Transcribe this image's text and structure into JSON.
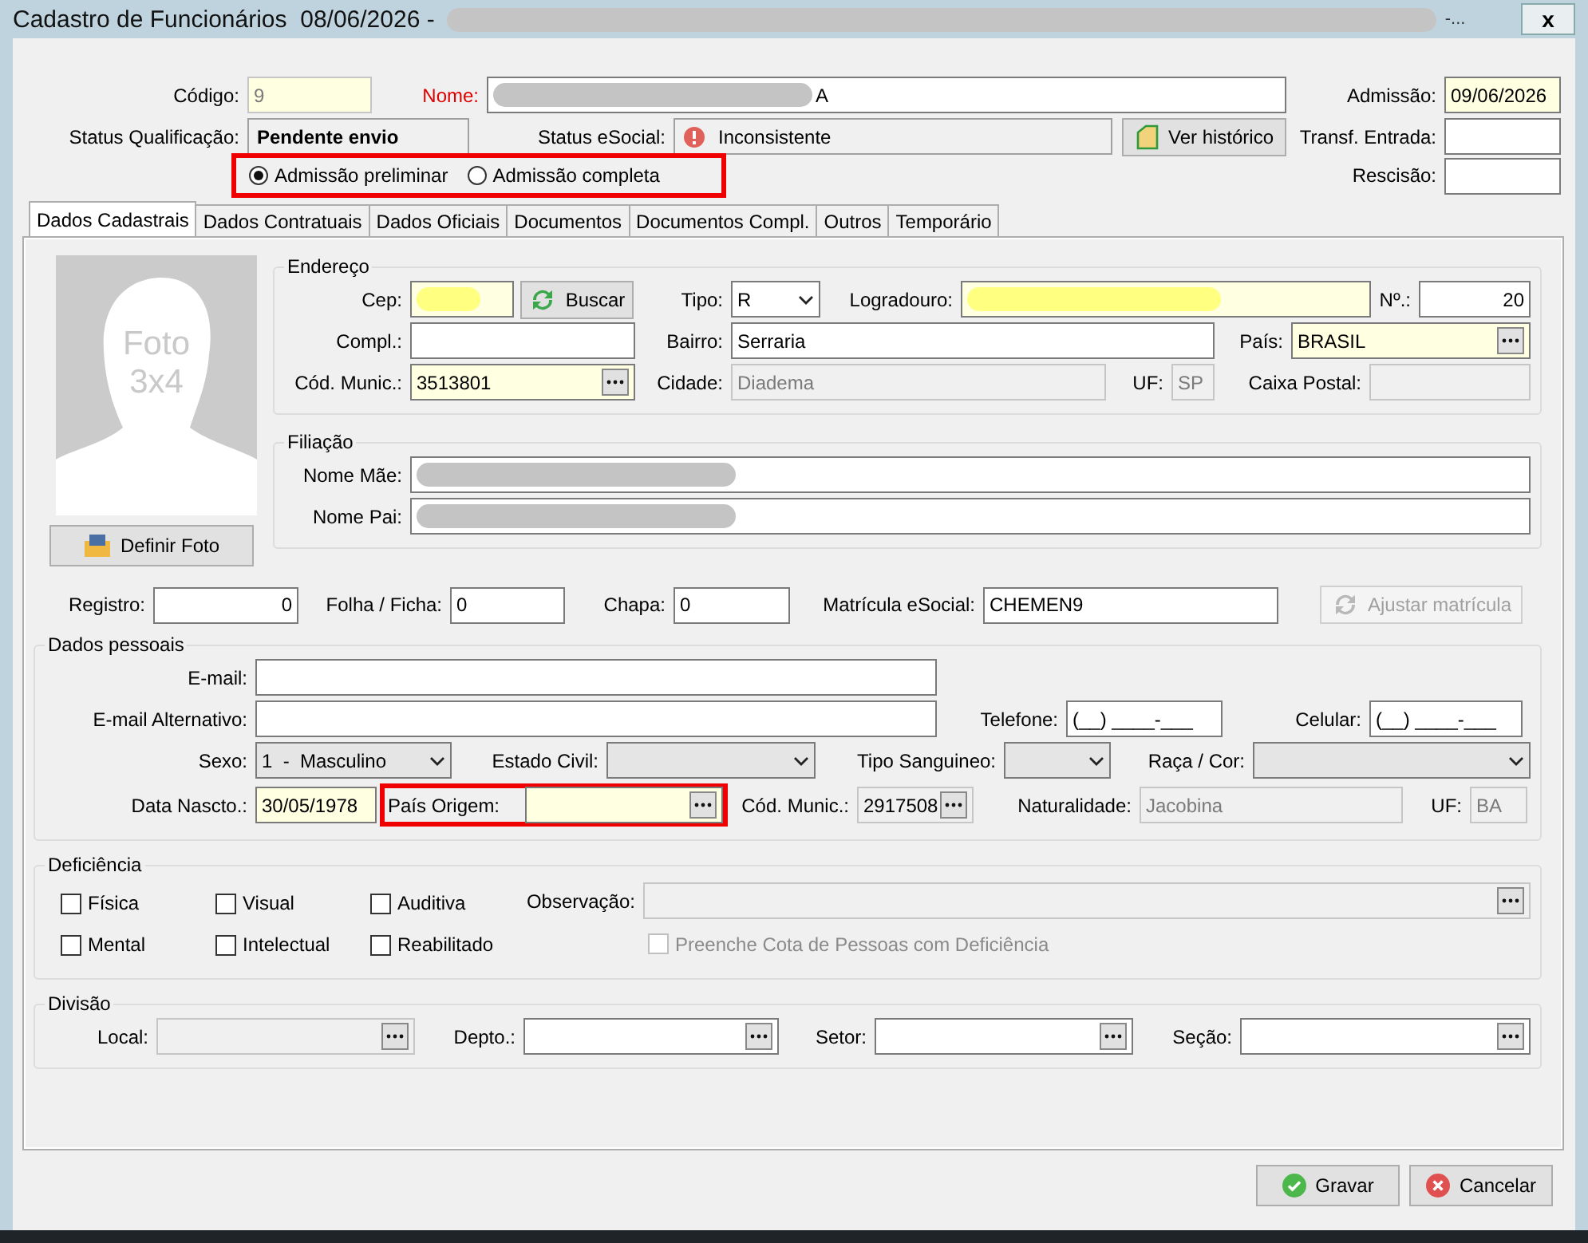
{
  "window": {
    "title": "Cadastro de Funcionários  08/06/2026 -",
    "title_redacted": true,
    "title_tail": "-...",
    "close": "x"
  },
  "header": {
    "codigo": {
      "label": "Código:",
      "value": "9",
      "required": true,
      "disabled": true
    },
    "nome": {
      "label": "Nome:",
      "value": "A",
      "invalid": true,
      "redacted": true
    },
    "admissao": {
      "label": "Admissão:",
      "value": "09/06/2026",
      "required": true
    },
    "status_qualificacao": {
      "label": "Status Qualificação:",
      "value": "Pendente envio"
    },
    "status_esocial": {
      "label": "Status eSocial:",
      "value": "Inconsistente"
    },
    "history_button": "Ver histórico",
    "transf_entrada": {
      "label": "Transf. Entrada:"
    },
    "rescisao": {
      "label": "Rescisão:"
    },
    "admission_type": {
      "highlighted": true,
      "options": [
        {
          "label": "Admissão preliminar",
          "selected": true
        },
        {
          "label": "Admissão completa",
          "selected": false
        }
      ]
    }
  },
  "tabs": [
    {
      "label": "Dados Cadastrais",
      "selected": true
    },
    {
      "label": "Dados Contratuais",
      "selected": false
    },
    {
      "label": "Dados Oficiais",
      "selected": false
    },
    {
      "label": "Documentos",
      "selected": false
    },
    {
      "label": "Documentos Compl.",
      "selected": false
    },
    {
      "label": "Outros",
      "selected": false
    },
    {
      "label": "Temporário",
      "selected": false
    }
  ],
  "photo": {
    "caption": [
      "Foto",
      "3x4"
    ],
    "button": "Definir Foto"
  },
  "endereco": {
    "title": "Endereço",
    "cep": {
      "label": "Cep:",
      "required": true,
      "redacted": true
    },
    "search_button": "Buscar",
    "tipo": {
      "label": "Tipo:",
      "value": "R",
      "editable": true
    },
    "logradouro": {
      "label": "Logradouro:",
      "required": true,
      "redacted": true
    },
    "numero": {
      "label": "Nº.:",
      "value": "20"
    },
    "compl": {
      "label": "Compl.:"
    },
    "bairro": {
      "label": "Bairro:",
      "value": "Serraria"
    },
    "pais": {
      "label": "País:",
      "value": "BRASIL",
      "required": true
    },
    "cod_munic": {
      "label": "Cód. Munic.:",
      "value": "3513801",
      "required": true
    },
    "cidade": {
      "label": "Cidade:",
      "value": "Diadema",
      "disabled": true
    },
    "uf": {
      "label": "UF:",
      "value": "SP",
      "disabled": true
    },
    "caixa_postal": {
      "label": "Caixa Postal:",
      "disabled": true
    }
  },
  "filiacao": {
    "title": "Filiação",
    "mae": {
      "label": "Nome Mãe:",
      "redacted": true
    },
    "pai": {
      "label": "Nome Pai:",
      "redacted": true
    }
  },
  "registro": {
    "registro": {
      "label": "Registro:",
      "value": "0"
    },
    "folha": {
      "label": "Folha / Ficha:",
      "value": "0"
    },
    "chapa": {
      "label": "Chapa:",
      "value": "0"
    },
    "matricula": {
      "label": "Matrícula eSocial:",
      "value": "CHEMEN9"
    },
    "adjust_button": {
      "label": "Ajustar matrícula",
      "disabled": true
    }
  },
  "dados_pessoais": {
    "title": "Dados pessoais",
    "email": {
      "label": "E-mail:"
    },
    "email_alt": {
      "label": "E-mail Alternativo:"
    },
    "telefone": {
      "label": "Telefone:",
      "value": "(__) ____-___"
    },
    "celular": {
      "label": "Celular:",
      "value": "(__) ____-___"
    },
    "sexo": {
      "label": "Sexo:",
      "value": "1  -  Masculino",
      "editable": false
    },
    "estado_civil": {
      "label": "Estado Civil:",
      "editable": false
    },
    "tipo_sanguineo": {
      "label": "Tipo Sanguineo:",
      "editable": false
    },
    "raca": {
      "label": "Raça / Cor:",
      "editable": false
    },
    "nascimento": {
      "label": "Data Nascto.:",
      "value": "30/05/1978",
      "required": true
    },
    "pais_origem": {
      "label": "País Origem:",
      "required": true,
      "highlighted": true
    },
    "cod_munic": {
      "label": "Cód. Munic.:",
      "value": "2917508",
      "readonly": true
    },
    "naturalidade": {
      "label": "Naturalidade:",
      "value": "Jacobina",
      "disabled": true
    },
    "uf": {
      "label": "UF:",
      "value": "BA",
      "disabled": true
    }
  },
  "deficiencia": {
    "title": "Deficiência",
    "options": [
      {
        "label": "Física",
        "checked": false
      },
      {
        "label": "Visual",
        "checked": false
      },
      {
        "label": "Auditiva",
        "checked": false
      },
      {
        "label": "Mental",
        "checked": false
      },
      {
        "label": "Intelectual",
        "checked": false
      },
      {
        "label": "Reabilitado",
        "checked": false
      }
    ],
    "observacao": {
      "label": "Observação:",
      "disabled": true
    },
    "cota": {
      "label": "Preenche Cota de Pessoas com Deficiência",
      "checked": false,
      "disabled": true
    }
  },
  "divisao": {
    "title": "Divisão",
    "fields": [
      {
        "label": "Local:",
        "disabled": true
      },
      {
        "label": "Depto.:"
      },
      {
        "label": "Setor:"
      },
      {
        "label": "Seção:"
      }
    ]
  },
  "buttons": [
    {
      "kind": "save",
      "label": "Gravar"
    },
    {
      "kind": "cancel",
      "label": "Cancelar"
    }
  ]
}
